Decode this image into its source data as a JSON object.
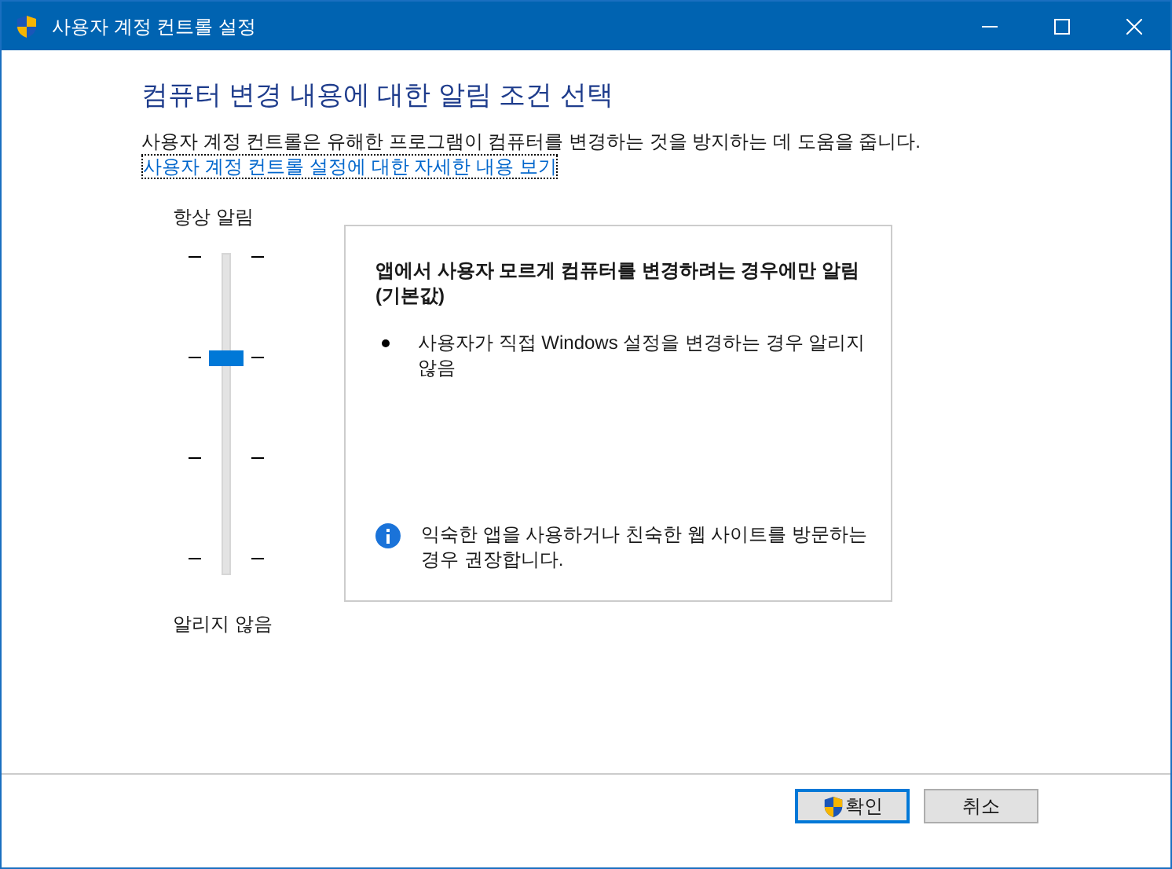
{
  "window": {
    "title": "사용자 계정 컨트롤 설정"
  },
  "heading": "컴퓨터 변경 내용에 대한 알림 조건 선택",
  "description": "사용자 계정 컨트롤은 유해한 프로그램이 컴퓨터를 변경하는 것을 방지하는 데 도움을 줍니다.",
  "link": {
    "label": "사용자 계정 컨트롤 설정에 대한 자세한 내용 보기",
    "focused": true
  },
  "slider": {
    "top_label": "항상 알림",
    "bottom_label": "알리지 않음",
    "level": 0.667
  },
  "info": {
    "title": "앱에서 사용자 모르게 컴퓨터를 변경하려는 경우에만 알림 (기본값)",
    "bullets": [
      "사용자가 직접 Windows 설정을 변경하는 경우 알리지 않음"
    ],
    "note": "익숙한 앱을 사용하거나 친숙한 웹 사이트를 방문하는 경우 권장합니다."
  },
  "buttons": [
    {
      "label": "확인",
      "default": true,
      "shield": true
    },
    {
      "label": "취소",
      "default": false,
      "shield": false
    }
  ]
}
